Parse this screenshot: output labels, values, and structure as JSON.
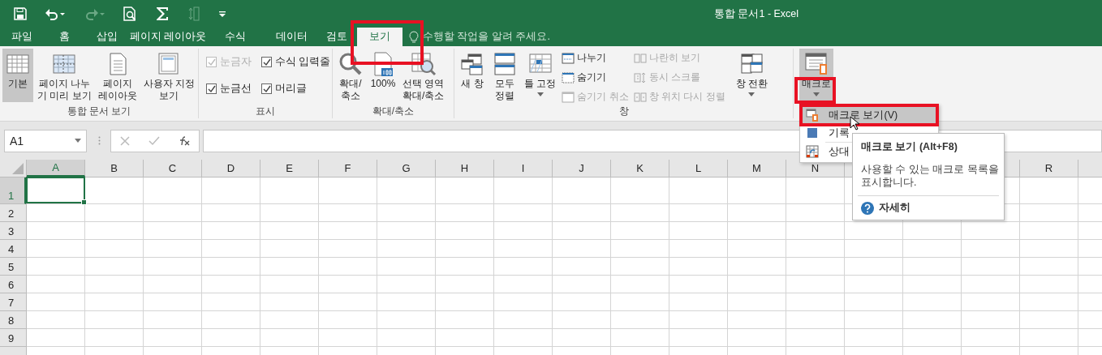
{
  "window": {
    "title": "통합 문서1 - Excel"
  },
  "quick_access": [
    {
      "disabled": false
    },
    {
      "disabled": false
    },
    {
      "disabled": true
    },
    {
      "disabled": false
    },
    {
      "disabled": false
    },
    {
      "disabled": true
    },
    {
      "disabled": false
    }
  ],
  "tabs": [
    {
      "label": "파일",
      "selected": false,
      "highlighted": false
    },
    {
      "label": "홈",
      "selected": false,
      "highlighted": false
    },
    {
      "label": "삽입",
      "selected": false,
      "highlighted": false
    },
    {
      "label": "페이지 레이아웃",
      "selected": false,
      "highlighted": false
    },
    {
      "label": "수식",
      "selected": false,
      "highlighted": false
    },
    {
      "label": "데이터",
      "selected": false,
      "highlighted": false
    },
    {
      "label": "검토",
      "selected": false,
      "highlighted": false
    },
    {
      "label": "보기",
      "selected": true,
      "highlighted": true
    }
  ],
  "tell_me": {
    "placeholder": "수행할 작업을 알려 주세요."
  },
  "ribbon": {
    "groups": [
      {
        "label": "통합 문서 보기",
        "items": [
          {
            "kind": "large",
            "label": "기본",
            "selected": true
          },
          {
            "kind": "large",
            "label": "페이지 나누\n기 미리 보기",
            "selected": false
          },
          {
            "kind": "large",
            "label": "페이지\n레이아웃",
            "selected": false
          },
          {
            "kind": "large",
            "label": "사용자 지정\n보기",
            "selected": false
          }
        ]
      },
      {
        "label": "표시",
        "items": [
          {
            "kind": "checkbox",
            "label": "눈금자",
            "checked": true,
            "disabled": true
          },
          {
            "kind": "checkbox",
            "label": "수식 입력줄",
            "checked": true,
            "disabled": false
          },
          {
            "kind": "checkbox",
            "label": "눈금선",
            "checked": true,
            "disabled": false
          },
          {
            "kind": "checkbox",
            "label": "머리글",
            "checked": true,
            "disabled": false
          }
        ]
      },
      {
        "label": "확대/축소",
        "items": [
          {
            "kind": "large",
            "label": "확대/\n축소",
            "selected": false
          },
          {
            "kind": "large",
            "label": "100%",
            "selected": false
          },
          {
            "kind": "large",
            "label": "선택 영역\n확대/축소",
            "selected": false
          }
        ]
      },
      {
        "label": "창",
        "items": [
          {
            "kind": "large",
            "label": "새 창",
            "selected": false
          },
          {
            "kind": "large",
            "label": "모두\n정렬",
            "selected": false
          },
          {
            "kind": "large",
            "label": "틀 고정",
            "selected": false,
            "dropdown": true
          },
          {
            "kind": "small",
            "items": [
              {
                "label": "나누기",
                "disabled": false
              },
              {
                "label": "숨기기",
                "disabled": false
              },
              {
                "label": "숨기기 취소",
                "disabled": true
              }
            ]
          },
          {
            "kind": "small",
            "items": [
              {
                "label": "나란히 보기",
                "disabled": true
              },
              {
                "label": "동시 스크롤",
                "disabled": true
              },
              {
                "label": "창 위치 다시 정렬",
                "disabled": true
              }
            ]
          },
          {
            "kind": "large",
            "label": "창 전환",
            "selected": false,
            "dropdown": true
          }
        ]
      },
      {
        "items": [
          {
            "kind": "large",
            "label": "매크로",
            "selected": true,
            "dropdown": true,
            "highlighted": true
          }
        ]
      }
    ]
  },
  "formula_bar": {
    "name_box": "A1"
  },
  "grid": {
    "columns": [
      {
        "label": "A",
        "selected": true
      },
      {
        "label": "B",
        "selected": false
      },
      {
        "label": "C",
        "selected": false
      },
      {
        "label": "D",
        "selected": false
      },
      {
        "label": "E",
        "selected": false
      },
      {
        "label": "F",
        "selected": false
      },
      {
        "label": "G",
        "selected": false
      },
      {
        "label": "H",
        "selected": false
      },
      {
        "label": "I",
        "selected": false
      },
      {
        "label": "J",
        "selected": false
      },
      {
        "label": "K",
        "selected": false
      },
      {
        "label": "L",
        "selected": false
      },
      {
        "label": "M",
        "selected": false
      },
      {
        "label": "N",
        "selected": false
      },
      {},
      {},
      {},
      {
        "label": "R",
        "selected": false
      }
    ],
    "rows": [
      {
        "label": "1",
        "selected": true
      },
      {
        "label": "2",
        "selected": false
      },
      {
        "label": "3",
        "selected": false
      },
      {
        "label": "4",
        "selected": false
      },
      {
        "label": "5",
        "selected": false
      },
      {
        "label": "6",
        "selected": false
      },
      {
        "label": "7",
        "selected": false
      },
      {
        "label": "8",
        "selected": false
      },
      {
        "label": "9",
        "selected": false
      }
    ]
  },
  "menu": {
    "items": [
      {
        "label": "매크로 보기(V)",
        "selected": true,
        "highlighted": true
      },
      {
        "label": "기록",
        "selected": false,
        "highlighted": false
      },
      {
        "label": "상대",
        "selected": false,
        "highlighted": false
      }
    ]
  },
  "tooltip": {
    "title": "매크로 보기 (Alt+F8)",
    "body": "사용할 수 있는 매크로 목록을\n표시합니다.",
    "link": "자세히"
  }
}
